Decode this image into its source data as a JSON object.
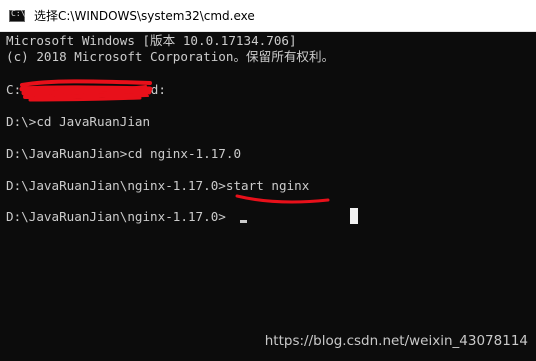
{
  "window": {
    "title": "选择C:\\WINDOWS\\system32\\cmd.exe",
    "icon": "cmd-icon"
  },
  "terminal": {
    "lines": {
      "version": "Microsoft Windows [版本 10.0.17134.706]",
      "copyright": "(c) 2018 Microsoft Corporation。保留所有权利。",
      "prompt_c_start": "C:",
      "prompt_c_end": ">d:",
      "cd_root": "D:\\>cd JavaRuanJian",
      "cd_nginx": "D:\\JavaRuanJian>cd nginx-1.17.0",
      "start_prompt": "D:\\JavaRuanJian\\nginx-1.17.0>",
      "start_command": "start nginx",
      "final_prompt": "D:\\JavaRuanJian\\nginx-1.17.0>"
    },
    "colors": {
      "background": "#0c0c0c",
      "text": "#cccccc",
      "annotation": "#e8101a"
    }
  },
  "watermark": "https://blog.csdn.net/weixin_43078114"
}
